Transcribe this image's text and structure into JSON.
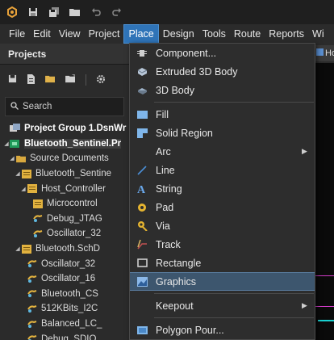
{
  "toolbar": {
    "icons": [
      "app-logo-icon",
      "save-icon",
      "save-all-icon",
      "open-folder-icon",
      "undo-icon",
      "redo-icon"
    ]
  },
  "menu_bar": {
    "items": [
      {
        "label": "File",
        "active": false
      },
      {
        "label": "Edit",
        "active": false
      },
      {
        "label": "View",
        "active": false
      },
      {
        "label": "Project",
        "active": false
      },
      {
        "label": "Place",
        "active": true
      },
      {
        "label": "Design",
        "active": false
      },
      {
        "label": "Tools",
        "active": false
      },
      {
        "label": "Route",
        "active": false
      },
      {
        "label": "Reports",
        "active": false
      },
      {
        "label": "Wi",
        "active": false
      }
    ]
  },
  "projects_panel": {
    "title": "Projects",
    "search_placeholder": "Search",
    "tree": [
      {
        "label": "Project Group 1.DsnWr",
        "level": 0,
        "bold": true,
        "arrow": "",
        "icon": "project-group-icon"
      },
      {
        "label": "Bluetooth_Sentinel.Pr",
        "level": 0,
        "bold": true,
        "arrow": "◢",
        "icon": "pcb-project-icon",
        "selected": true
      },
      {
        "label": "Source Documents",
        "level": 1,
        "bold": false,
        "arrow": "◢",
        "icon": "folder-icon"
      },
      {
        "label": "Bluetooth_Sentine",
        "level": 2,
        "bold": false,
        "arrow": "◢",
        "icon": "schematic-icon"
      },
      {
        "label": "Host_Controller",
        "level": 3,
        "bold": false,
        "arrow": "◢",
        "icon": "schematic-icon"
      },
      {
        "label": "Microcontrol",
        "level": 4,
        "bold": false,
        "arrow": "",
        "icon": "schematic-icon"
      },
      {
        "label": "Debug_JTAG",
        "level": 4,
        "bold": false,
        "arrow": "",
        "icon": "harness-icon"
      },
      {
        "label": "Oscillator_32",
        "level": 4,
        "bold": false,
        "arrow": "",
        "icon": "harness-icon"
      },
      {
        "label": "Bluetooth.SchD",
        "level": 2,
        "bold": false,
        "arrow": "◢",
        "icon": "schematic-icon"
      },
      {
        "label": "Oscillator_32",
        "level": 3,
        "bold": false,
        "arrow": "",
        "icon": "harness-icon"
      },
      {
        "label": "Oscillator_16",
        "level": 3,
        "bold": false,
        "arrow": "",
        "icon": "harness-icon"
      },
      {
        "label": "Bluetooth_CS",
        "level": 3,
        "bold": false,
        "arrow": "",
        "icon": "harness-icon"
      },
      {
        "label": "512KBits_I2C",
        "level": 3,
        "bold": false,
        "arrow": "",
        "icon": "harness-icon"
      },
      {
        "label": "Balanced_LC_",
        "level": 3,
        "bold": false,
        "arrow": "",
        "icon": "harness-icon"
      },
      {
        "label": "Debug_SDIO",
        "level": 3,
        "bold": false,
        "arrow": "",
        "icon": "harness-icon"
      }
    ]
  },
  "doc_tab": {
    "label": "Ho"
  },
  "place_menu": {
    "items": [
      {
        "label": "Component...",
        "icon": "component-icon",
        "submenu": false
      },
      {
        "label": "Extruded 3D Body",
        "icon": "extruded-3d-body-icon",
        "submenu": false
      },
      {
        "label": "3D Body",
        "icon": "3d-body-icon",
        "submenu": false
      },
      {
        "separator": true
      },
      {
        "label": "Fill",
        "icon": "fill-icon",
        "submenu": false
      },
      {
        "label": "Solid Region",
        "icon": "solid-region-icon",
        "submenu": false
      },
      {
        "label": "Arc",
        "icon": "",
        "submenu": true
      },
      {
        "label": "Line",
        "icon": "line-icon",
        "submenu": false
      },
      {
        "label": "String",
        "icon": "string-icon",
        "submenu": false
      },
      {
        "label": "Pad",
        "icon": "pad-icon",
        "submenu": false
      },
      {
        "label": "Via",
        "icon": "via-icon",
        "submenu": false
      },
      {
        "label": "Track",
        "icon": "track-icon",
        "submenu": false
      },
      {
        "label": "Rectangle",
        "icon": "rectangle-icon",
        "submenu": false
      },
      {
        "label": "Graphics",
        "icon": "graphics-icon",
        "submenu": false,
        "highlighted": true
      },
      {
        "separator": true
      },
      {
        "label": "Keepout",
        "icon": "",
        "submenu": true
      },
      {
        "separator": true
      },
      {
        "label": "Polygon Pour...",
        "icon": "polygon-pour-icon",
        "submenu": false
      }
    ]
  },
  "colors": {
    "menu_active": "#2f74b8",
    "menu_highlight": "#3d566e",
    "canvas_magenta": "#d23cc9",
    "canvas_cyan": "#19d0d0"
  }
}
